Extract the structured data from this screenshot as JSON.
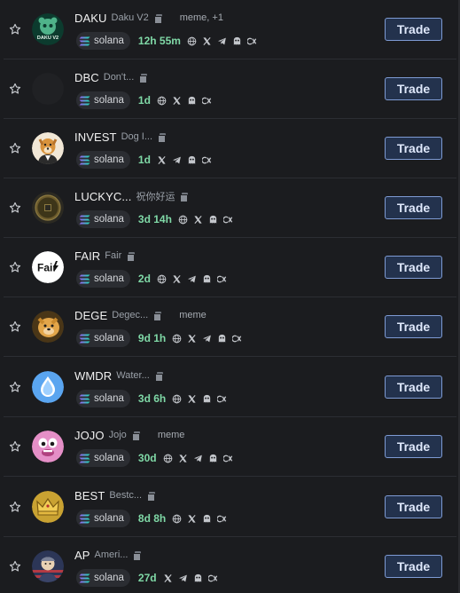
{
  "rows": [
    {
      "ticker": "DAKU",
      "name": "Daku V2",
      "tag": "meme, +1",
      "chain": "solana",
      "age": "12h 55m",
      "links": [
        "globe-icon",
        "x-icon",
        "telegram-icon",
        "pump-icon",
        "cx-icon"
      ],
      "avatar": "daku"
    },
    {
      "ticker": "DBC",
      "name": "Don't...",
      "tag": "",
      "chain": "solana",
      "age": "1d",
      "links": [
        "globe-icon",
        "x-icon",
        "pump-icon",
        "cx-icon"
      ],
      "avatar": "dark"
    },
    {
      "ticker": "INVEST",
      "name": "Dog I...",
      "tag": "",
      "chain": "solana",
      "age": "1d",
      "links": [
        "x-icon",
        "telegram-icon",
        "pump-icon",
        "cx-icon"
      ],
      "avatar": "dog"
    },
    {
      "ticker": "LUCKYC...",
      "name": "祝你好运",
      "tag": "",
      "chain": "solana",
      "age": "3d 14h",
      "links": [
        "globe-icon",
        "x-icon",
        "pump-icon",
        "cx-icon"
      ],
      "avatar": "coin"
    },
    {
      "ticker": "FAIR",
      "name": "Fair",
      "tag": "",
      "chain": "solana",
      "age": "2d",
      "links": [
        "globe-icon",
        "x-icon",
        "telegram-icon",
        "pump-icon",
        "cx-icon"
      ],
      "avatar": "fair"
    },
    {
      "ticker": "DEGE",
      "name": "Degec...",
      "tag": "meme",
      "chain": "solana",
      "age": "9d 1h",
      "links": [
        "globe-icon",
        "x-icon",
        "telegram-icon",
        "pump-icon",
        "cx-icon"
      ],
      "avatar": "dege"
    },
    {
      "ticker": "WMDR",
      "name": "Water...",
      "tag": "",
      "chain": "solana",
      "age": "3d 6h",
      "links": [
        "globe-icon",
        "x-icon",
        "pump-icon",
        "cx-icon"
      ],
      "avatar": "water"
    },
    {
      "ticker": "JOJO",
      "name": "Jojo",
      "tag": "meme",
      "chain": "solana",
      "age": "30d",
      "links": [
        "globe-icon",
        "x-icon",
        "telegram-icon",
        "pump-icon",
        "cx-icon"
      ],
      "avatar": "jojo"
    },
    {
      "ticker": "BEST",
      "name": "Bestc...",
      "tag": "",
      "chain": "solana",
      "age": "8d 8h",
      "links": [
        "globe-icon",
        "x-icon",
        "pump-icon",
        "cx-icon"
      ],
      "avatar": "crown"
    },
    {
      "ticker": "AP",
      "name": "Ameri...",
      "tag": "",
      "chain": "solana",
      "age": "27d",
      "links": [
        "x-icon",
        "telegram-icon",
        "pump-icon",
        "cx-icon"
      ],
      "avatar": "ap"
    }
  ],
  "trade_label": "Trade",
  "colors": {
    "background": "#1b1c1f",
    "age": "#7fd8a6",
    "button_border": "#7e9bd4",
    "button_fill": "#23324d"
  }
}
